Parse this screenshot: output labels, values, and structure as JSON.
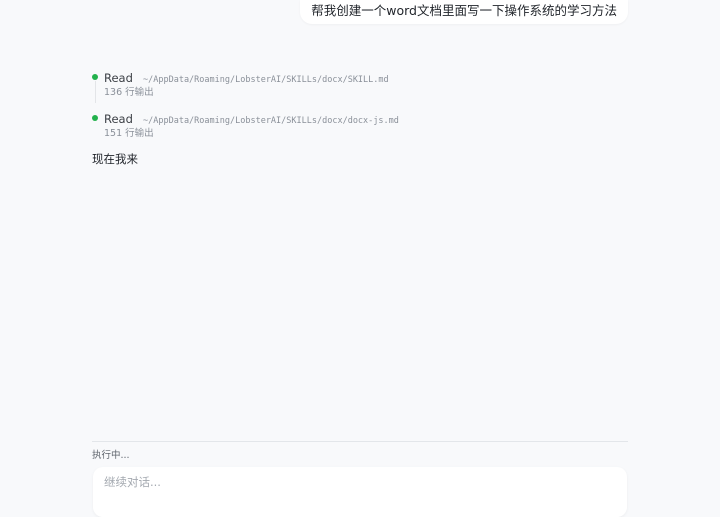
{
  "conversation": {
    "user_message": "帮我创建一个word文档里面写一下操作系统的学习方法",
    "tool_calls": [
      {
        "tool": "Read",
        "path": "~/AppData/Roaming/LobsterAI/SKILLs/docx/SKILL.md",
        "output": "136 行输出",
        "status_color": "#22b14c"
      },
      {
        "tool": "Read",
        "path": "~/AppData/Roaming/LobsterAI/SKILLs/docx/docx-js.md",
        "output": "151 行输出",
        "status_color": "#22b14c"
      }
    ],
    "assistant_message": "现在我来"
  },
  "composer": {
    "status": "执行中...",
    "input_value": "",
    "placeholder": "继续对话..."
  }
}
